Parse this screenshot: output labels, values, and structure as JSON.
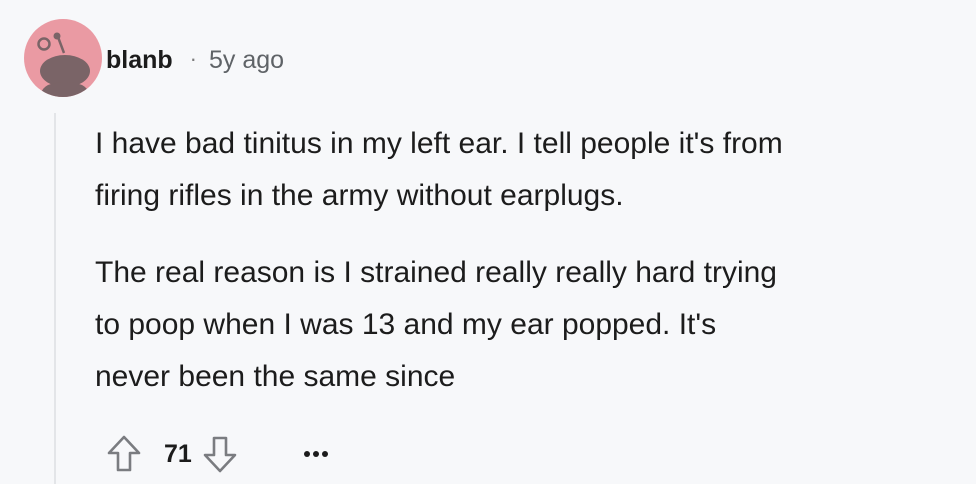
{
  "comment": {
    "author": "blanb",
    "separator": "·",
    "time_ago": "5y ago",
    "paragraphs": [
      "I have bad tinitus in my left ear. I tell people it's from",
      "firing rifles in the army without earplugs.",
      "The real reason is I strained really really hard trying",
      "to poop when I was 13 and my ear popped. It's",
      "never been the same since"
    ],
    "score": "71",
    "avatar_icon": "snoo-avatar-icon",
    "upvote_icon": "upvote-arrow-icon",
    "downvote_icon": "downvote-arrow-icon",
    "more_icon": "more-options-icon"
  },
  "colors": {
    "background": "#f7f8fa",
    "avatar_bg": "#ea9aa3",
    "avatar_figure": "#7a6467",
    "text": "#1c1c1c",
    "muted": "#5f6367",
    "thread_line": "#e3e5e8"
  }
}
